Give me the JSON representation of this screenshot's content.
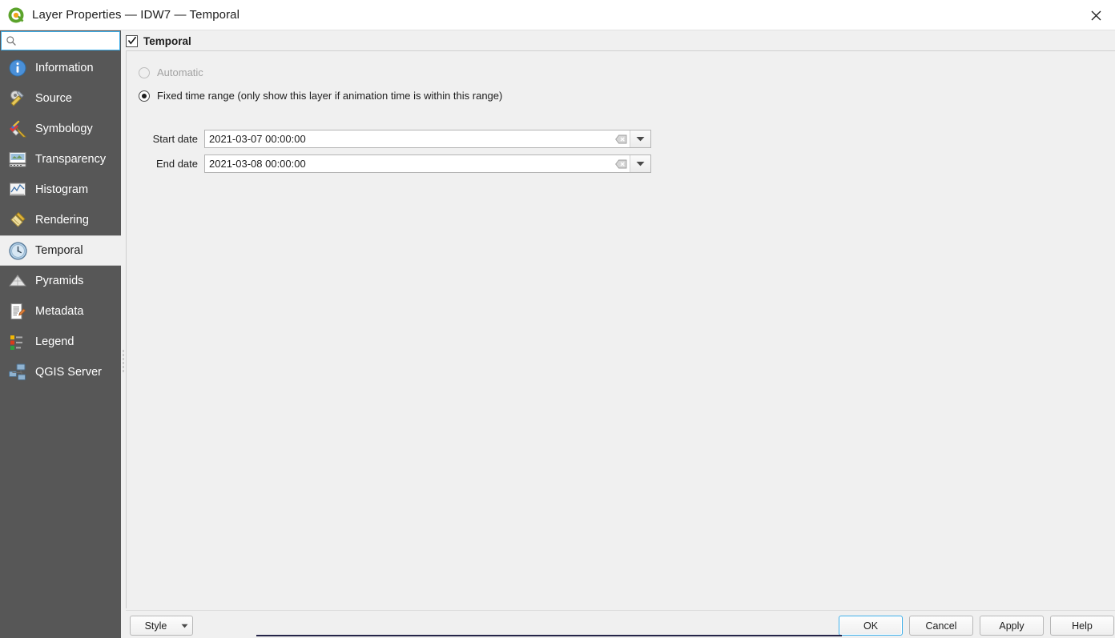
{
  "window": {
    "title": "Layer Properties — IDW7 — Temporal",
    "app_icon": "qgis-logo-icon",
    "close_label": "✕"
  },
  "sidebar": {
    "search": {
      "value": "",
      "placeholder": "",
      "icon": "search-icon"
    },
    "items": [
      {
        "label": "Information",
        "icon": "information-icon",
        "selected": false
      },
      {
        "label": "Source",
        "icon": "source-icon",
        "selected": false
      },
      {
        "label": "Symbology",
        "icon": "symbology-icon",
        "selected": false
      },
      {
        "label": "Transparency",
        "icon": "transparency-icon",
        "selected": false
      },
      {
        "label": "Histogram",
        "icon": "histogram-icon",
        "selected": false
      },
      {
        "label": "Rendering",
        "icon": "rendering-icon",
        "selected": false
      },
      {
        "label": "Temporal",
        "icon": "clock-icon",
        "selected": true
      },
      {
        "label": "Pyramids",
        "icon": "pyramids-icon",
        "selected": false
      },
      {
        "label": "Metadata",
        "icon": "metadata-icon",
        "selected": false
      },
      {
        "label": "Legend",
        "icon": "legend-icon",
        "selected": false
      },
      {
        "label": "QGIS Server",
        "icon": "qgis-server-icon",
        "selected": false
      }
    ]
  },
  "main": {
    "group": {
      "title": "Temporal",
      "checked": true
    },
    "modes": [
      {
        "label": "Automatic",
        "selected": false,
        "disabled": true
      },
      {
        "label": "Fixed time range (only show this layer if animation time is within this range)",
        "selected": true,
        "disabled": false
      }
    ],
    "fields": [
      {
        "label": "Start date",
        "value": "2021-03-07 00:00:00",
        "clear_icon": "clear-icon",
        "dropdown_icon": "chevron-down-icon"
      },
      {
        "label": "End date",
        "value": "2021-03-08 00:00:00",
        "clear_icon": "clear-icon",
        "dropdown_icon": "chevron-down-icon"
      }
    ]
  },
  "footer": {
    "style_label": "Style",
    "style_caret": "▼",
    "ok_label": "OK",
    "cancel_label": "Cancel",
    "apply_label": "Apply",
    "help_label": "Help"
  },
  "colors": {
    "sidebar_bg": "#575757",
    "panel_bg": "#f0f0f0",
    "accent": "#3daee9",
    "text": "#1d1d1d",
    "disabled_text": "#a2a2a2"
  }
}
